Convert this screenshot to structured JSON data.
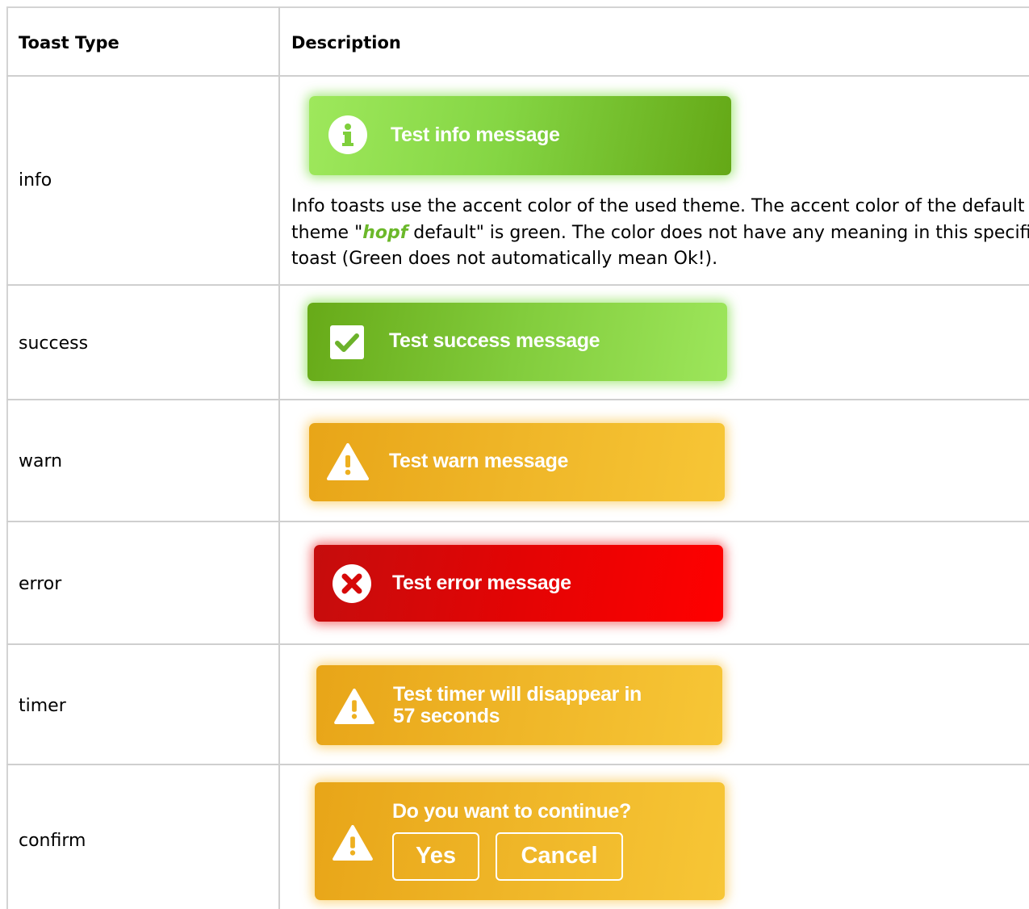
{
  "table": {
    "headers": {
      "type": "Toast Type",
      "description": "Description"
    },
    "rows": [
      {
        "type": "info",
        "toast_message": "Test info message",
        "icon": "info-circle-icon",
        "color": "#85d644",
        "description": {
          "before": "Info toasts use the accent color of the used theme. The accent color of the default",
          "theme_prefix": "theme \"",
          "theme_name": "hopf",
          "theme_suffix": " default\" is green. The color does not have any meaning in this specific",
          "line3": "toast (Green does not automatically mean Ok!)."
        }
      },
      {
        "type": "success",
        "toast_message": "Test success message",
        "icon": "checkbox-check-icon",
        "color": "#82cc3c"
      },
      {
        "type": "warn",
        "toast_message": "Test warn message",
        "icon": "warning-triangle-icon",
        "color": "#efb628"
      },
      {
        "type": "error",
        "toast_message": "Test error message",
        "icon": "error-circle-x-icon",
        "color": "#e30404"
      },
      {
        "type": "timer",
        "toast_message_line1": "Test timer will disappear in",
        "toast_message_line2": "57 seconds",
        "icon": "warning-triangle-icon",
        "color": "#efb628"
      },
      {
        "type": "confirm",
        "toast_message": "Do you want to continue?",
        "icon": "warning-triangle-icon",
        "color": "#efb628",
        "buttons": {
          "yes": "Yes",
          "cancel": "Cancel"
        }
      }
    ]
  }
}
